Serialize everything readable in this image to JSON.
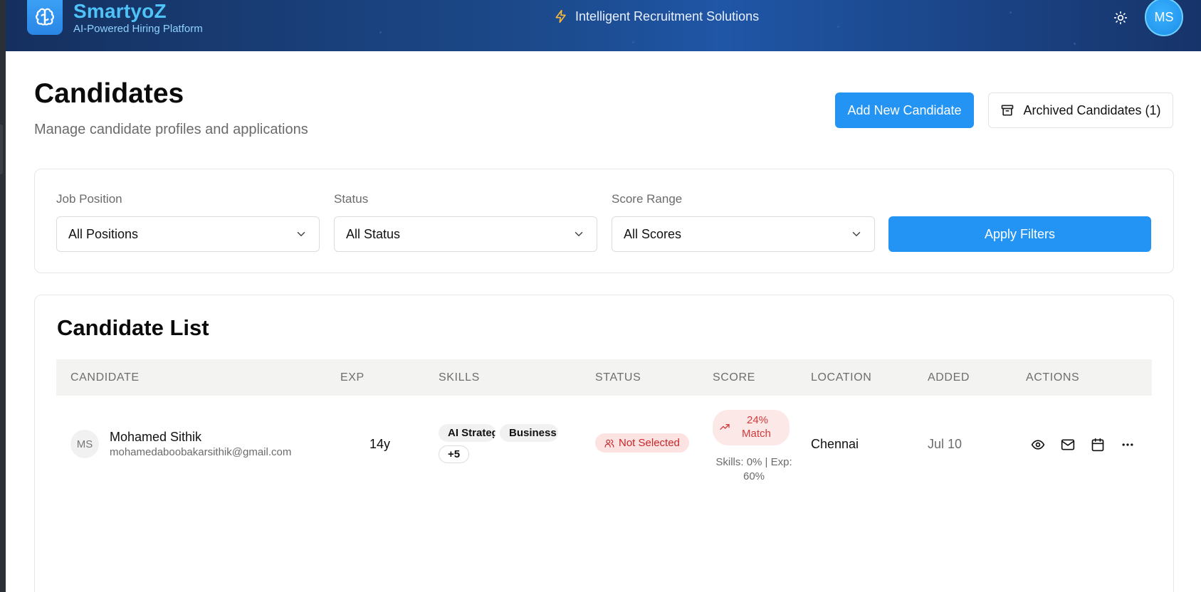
{
  "header": {
    "brand_name": "SmartyoZ",
    "brand_tagline": "AI-Powered Hiring Platform",
    "slogan": "Intelligent Recruitment Solutions",
    "user_initials": "MS"
  },
  "page": {
    "title": "Candidates",
    "subtitle": "Manage candidate profiles and applications",
    "add_button": "Add New Candidate",
    "archived_button": "Archived Candidates (1)"
  },
  "filters": {
    "job_position_label": "Job Position",
    "job_position_value": "All Positions",
    "status_label": "Status",
    "status_value": "All Status",
    "score_label": "Score Range",
    "score_value": "All Scores",
    "apply_button": "Apply Filters"
  },
  "list": {
    "title": "Candidate List",
    "columns": [
      "CANDIDATE",
      "EXP",
      "SKILLS",
      "STATUS",
      "SCORE",
      "LOCATION",
      "ADDED",
      "ACTIONS"
    ],
    "rows": [
      {
        "initials": "MS",
        "name": "Mohamed Sithik",
        "email": "mohamedaboobakarsithik@gmail.com",
        "exp": "14y",
        "skills": [
          "AI Strategy",
          "Business"
        ],
        "skills_more": "+5",
        "status": "Not Selected",
        "score_pct": "24%",
        "score_label": "Match",
        "score_detail_1": "Skills: 0% | Exp:",
        "score_detail_2": "60%",
        "location": "Chennai",
        "added": "Jul 10"
      }
    ]
  },
  "colors": {
    "accent": "#2394f3",
    "header_bg": "#1c4a8c",
    "status_bad_bg": "#fde2e2",
    "status_bad_text": "#c62828"
  },
  "icons": {
    "logo": "brain-icon",
    "slogan": "lightning-icon",
    "theme": "sun-icon",
    "archive": "archive-box-icon",
    "status": "users-icon",
    "score": "trending-up-icon",
    "actions": [
      "eye-icon",
      "mail-icon",
      "calendar-icon",
      "more-horizontal-icon"
    ]
  }
}
